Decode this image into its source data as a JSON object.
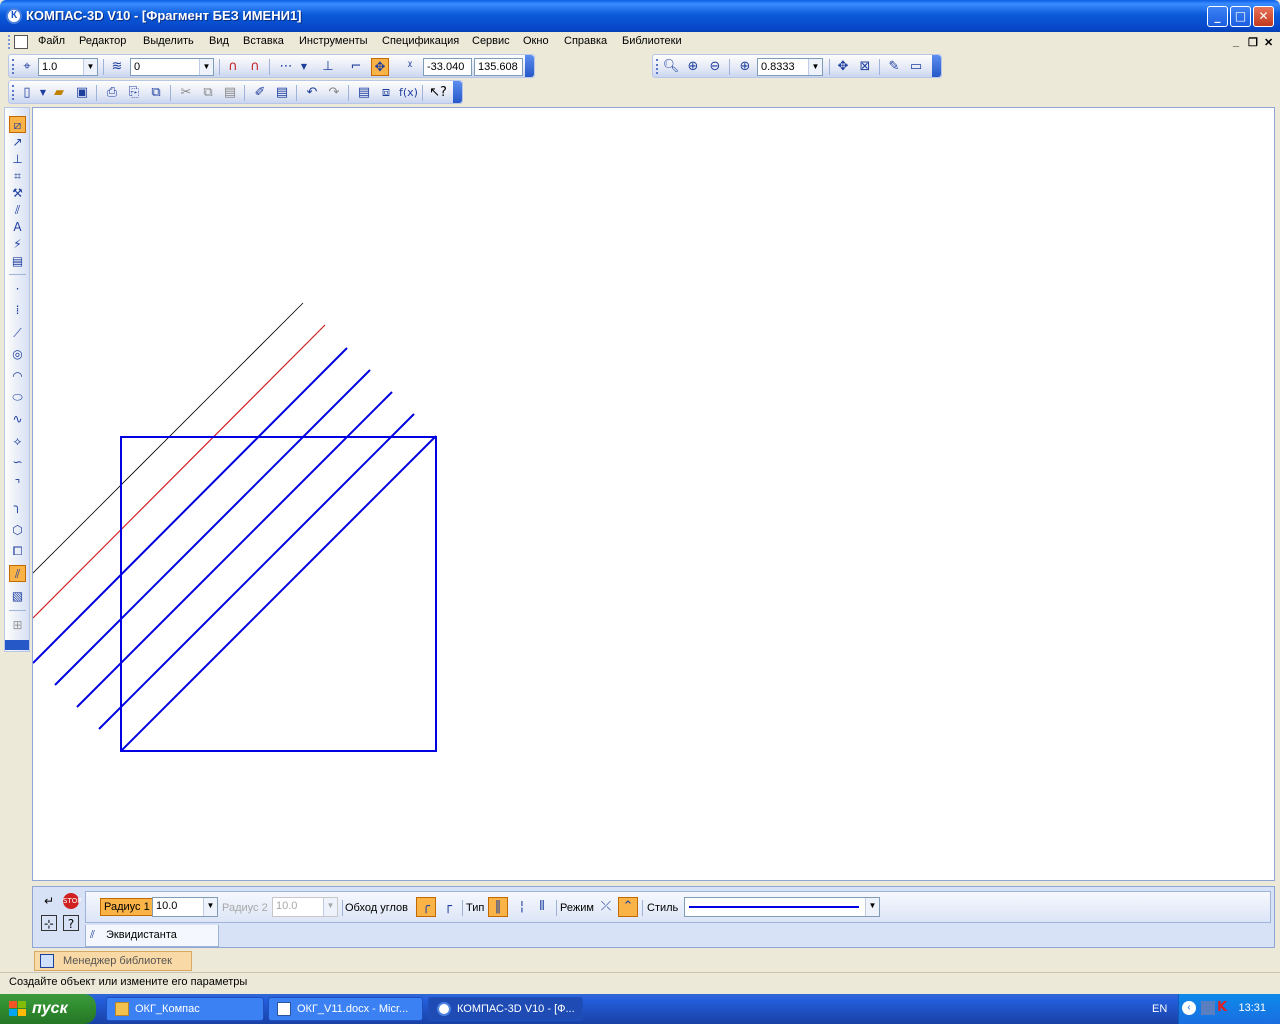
{
  "window": {
    "app_icon": "К",
    "title": "КОМПАС-3D V10 - [Фрагмент БЕЗ ИМЕНИ1]",
    "minimize": "_",
    "maximize": "□",
    "close": "✕"
  },
  "menu": {
    "items": [
      "Файл",
      "Редактор",
      "Выделить",
      "Вид",
      "Вставка",
      "Инструменты",
      "Спецификация",
      "Сервис",
      "Окно",
      "Справка",
      "Библиотеки"
    ],
    "mdi_minimize": "_",
    "mdi_restore": "❐",
    "mdi_close": "✕"
  },
  "toolbar_current": {
    "step_value": "1.0",
    "layer_value": "0",
    "coord_x": "-33.040",
    "coord_y": "135.608"
  },
  "toolbar_view": {
    "zoom_value": "0.8333"
  },
  "properties": {
    "radius1_label": "Радиус 1",
    "radius1_value": "10.0",
    "radius2_label": "Радиус 2",
    "radius2_value": "10.0",
    "corner_label": "Обход углов",
    "type_label": "Тип",
    "mode_label": "Режим",
    "style_label": "Стиль",
    "tab_label": "Эквидистанта"
  },
  "library_manager": "Менеджер библиотек",
  "status_text": "Создайте объект или измените его параметры",
  "taskbar": {
    "start_label": "пуск",
    "tasks": [
      "ОКГ_Компас",
      "ОКГ_V11.docx - Micr...",
      "КОМПАС-3D V10 - [Ф..."
    ],
    "lang": "EN",
    "time": "13:31"
  },
  "colors": {
    "accent": "#0000E0",
    "helper_red": "#D02020",
    "active_button": "#F9B347",
    "title_blue": "#0B5BDA"
  }
}
